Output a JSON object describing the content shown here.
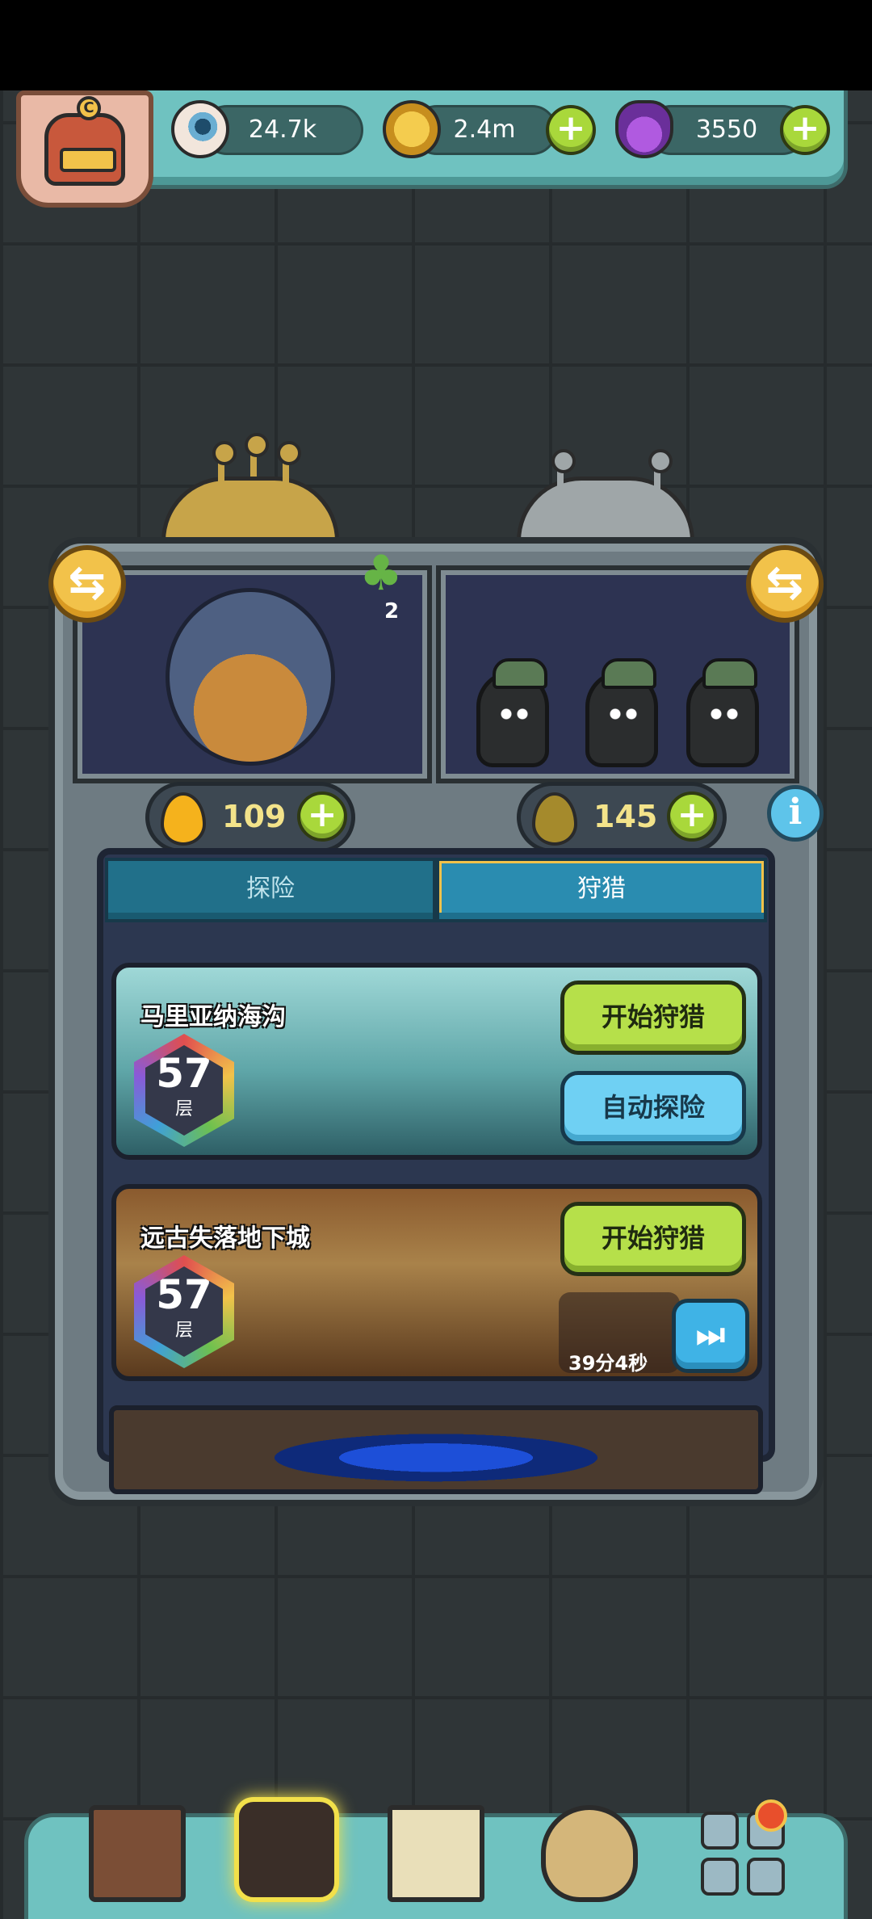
{
  "resources": {
    "eyes": {
      "value": "24.7k",
      "icon": "eyeball-icon"
    },
    "coins": {
      "value": "2.4m",
      "icon": "coin-icon"
    },
    "potions": {
      "value": "3550",
      "icon": "potion-icon"
    },
    "plus_symbol": "+"
  },
  "avatar": {
    "letter": "C"
  },
  "clover": {
    "count": "2"
  },
  "energy": {
    "left": {
      "value": "109",
      "color": "#f5b21c"
    },
    "right": {
      "value": "145",
      "color": "#a58a2c"
    }
  },
  "swap_symbol": "⇆",
  "info_symbol": "i",
  "tabs": [
    {
      "label": "探险",
      "active": false
    },
    {
      "label": "狩猎",
      "active": true
    }
  ],
  "dungeons": [
    {
      "name": "马里亚纳海沟",
      "level": "57",
      "level_unit": "层",
      "primary_button": "开始狩猎",
      "secondary_button": "自动探险"
    },
    {
      "name": "远古失落地下城",
      "level": "57",
      "level_unit": "层",
      "primary_button": "开始狩猎",
      "timer": "39分4秒",
      "skip_symbol": "⏭"
    }
  ],
  "bottom_nav": [
    {
      "icon": "building-icon"
    },
    {
      "icon": "hunter-icon",
      "active": true
    },
    {
      "icon": "book-icon"
    },
    {
      "icon": "money-bag-icon"
    },
    {
      "icon": "grid-menu-icon",
      "notification": true
    }
  ],
  "colors": {
    "accent_green": "#b6e04a",
    "accent_blue": "#6fd0f3",
    "panel_teal": "#6fc2c0"
  }
}
